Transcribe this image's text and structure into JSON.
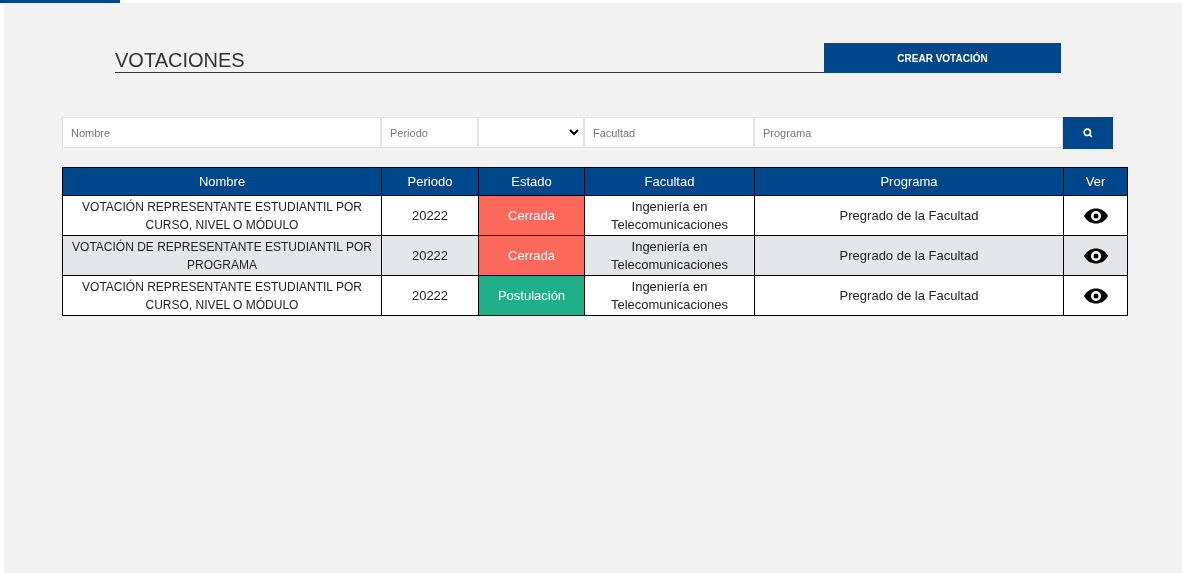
{
  "title": "VOTACIONES",
  "create_button": "CREAR VOTACIÓN",
  "filters": {
    "nombre": {
      "placeholder": "Nombre"
    },
    "periodo": {
      "placeholder": "Periodo"
    },
    "facultad": {
      "placeholder": "Facultad"
    },
    "programa": {
      "placeholder": "Programa"
    }
  },
  "table": {
    "columns": [
      "Nombre",
      "Periodo",
      "Estado",
      "Facultad",
      "Programa",
      "Ver"
    ],
    "rows": [
      {
        "nombre": "VOTACIÓN REPRESENTANTE ESTUDIANTIL POR CURSO, NIVEL O MÓDULO",
        "periodo": "20222",
        "estado": "Cerrada",
        "color": "#fd6a5c",
        "facultad": "Ingeniería en Telecomunicaciones",
        "programa": "Pregrado de la Facultad"
      },
      {
        "nombre": "VOTACIÓN DE REPRESENTANTE ESTUDIANTIL POR PROGRAMA",
        "periodo": "20222",
        "estado": "Cerrada",
        "color": "#fd6a5c",
        "facultad": "Ingeniería en Telecomunicaciones",
        "programa": "Pregrado de la Facultad"
      },
      {
        "nombre": "VOTACIÓN REPRESENTANTE ESTUDIANTIL POR CURSO, NIVEL O MÓDULO",
        "periodo": "20222",
        "estado": "Postulación",
        "color": "#1fb08a",
        "facultad": "Ingeniería en Telecomunicaciones",
        "programa": "Pregrado de la Facultad"
      }
    ]
  }
}
